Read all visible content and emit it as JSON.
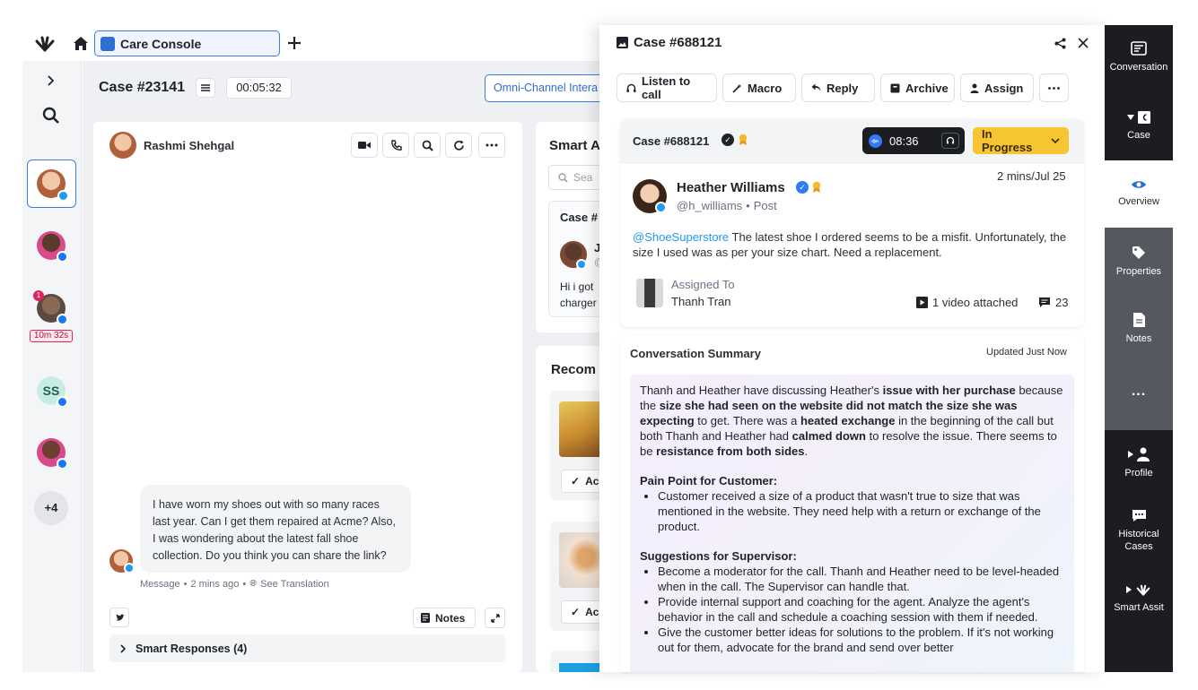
{
  "topbar": {
    "tab_label": "Care Console",
    "icons": [
      "app-logo-icon",
      "home-icon",
      "plus-icon"
    ]
  },
  "leftrail": {
    "timer_badge": "10m 32s",
    "notification_count": "1",
    "initials": "SS",
    "more_count": "+4"
  },
  "casebar": {
    "case_title": "Case #23141",
    "timer": "00:05:32",
    "channel_button": "Omni-Channel Intera"
  },
  "chat": {
    "contact_name": "Rashmi Shehgal",
    "message": "I have worn my shoes out with so many races last year. Can I get them repaired at Acme? Also, I was wondering about the latest fall shoe collection. Do you think you can share the link?",
    "meta_message": "Message",
    "meta_time": "2 mins ago",
    "meta_translate": "See Translation",
    "notes_label": "Notes",
    "smart_responses": "Smart Responses (4)"
  },
  "smart": {
    "title": "Smart A",
    "search_placeholder": "Sea",
    "case_label": "Case #",
    "snippet_name": "J",
    "snippet_handle": "@",
    "snippet_line1": "Hi i got",
    "snippet_line2": "charger",
    "recommend_title": "Recom",
    "action_label": "Ac"
  },
  "panel": {
    "title": "Case #688121",
    "actions": {
      "listen": "Listen to call",
      "macro": "Macro",
      "reply": "Reply",
      "archive": "Archive",
      "assign": "Assign"
    },
    "case_header": "Case #688121",
    "call_timer": "08:36",
    "status": "In Progress",
    "timestamp": "2 mins/Jul 25",
    "author_name": "Heather Williams",
    "author_handle": "@h_williams",
    "author_source": "Post",
    "mention": "@ShoeSuperstore",
    "post_text": " The latest shoe I ordered seems to be a misfit. Unfortunately, the size I used was as per your size chart. Need a replacement.",
    "assigned_label": "Assigned To",
    "assigned_name": "Thanh Tran",
    "video_label": "1 video attached",
    "comment_count": "23",
    "summary_title": "Conversation Summary",
    "summary_updated": "Updated Just Now",
    "summary": {
      "p1_a": "Thanh and Heather have discussing Heather's ",
      "p1_b": "issue with her purchase",
      "p1_c": " because the ",
      "p1_d": "size she had seen on the website did not match the size she was expecting",
      "p1_e": " to get. There was a ",
      "p1_f": "heated exchange",
      "p1_g": " in the beginning of the call but both Thanh and Heather had ",
      "p1_h": "calmed down",
      "p1_i": " to resolve the issue. There seems to be ",
      "p1_j": "resistance from both sides",
      "p1_k": ".",
      "pain_title": "Pain Point for Customer:",
      "pain_1": "Customer received a size of a product that wasn't true to size that was mentioned in the website. They need help with a return or exchange of the product.",
      "sugg_title": "Suggestions for Supervisor:",
      "sugg_1": "Become a moderator for the call. Thanh and Heather need to be level-headed when in the call. The Supervisor can handle that.",
      "sugg_2": "Provide internal support and coaching for the agent. Analyze the agent's behavior in the call and schedule a coaching session with them if needed.",
      "sugg_3": "Give the customer better ideas for solutions to the problem. If it's not working out for them, advocate for the brand and send over better"
    }
  },
  "rightrail": {
    "conversation": "Conversation",
    "case": "Case",
    "overview": "Overview",
    "properties": "Properties",
    "notes": "Notes",
    "more": "...",
    "profile": "Profile",
    "historical": "Historical Cases",
    "smart_assist": "Smart Assit"
  }
}
